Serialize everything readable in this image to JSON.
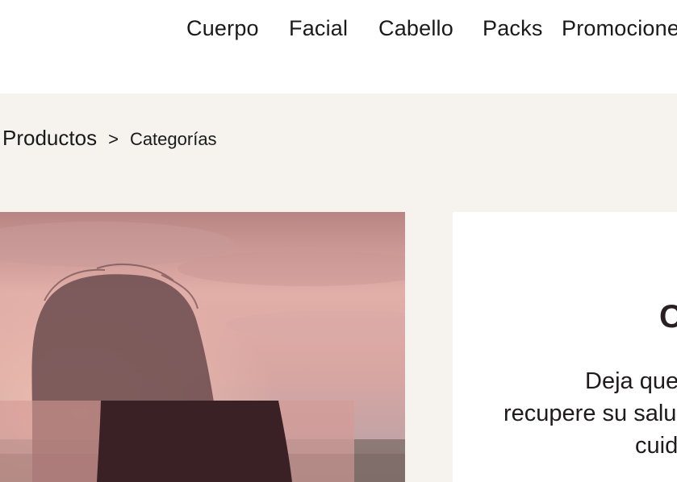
{
  "nav": {
    "items": [
      "Cuerpo",
      "Facial",
      "Cabello",
      "Packs",
      "Promocione"
    ]
  },
  "breadcrumb": {
    "root": "Productos",
    "separator": ">",
    "current": "Categorías"
  },
  "panel": {
    "heading_fragment": "C",
    "line1": "Deja que",
    "line2": "recupere su salu",
    "line3": "cuid"
  },
  "colors": {
    "page_bg": "#f6f3ef",
    "nav_bg": "#ffffff",
    "panel_bg": "#ffffff",
    "text": "#1f1a1c"
  },
  "icons": [
    "photo-hero"
  ]
}
